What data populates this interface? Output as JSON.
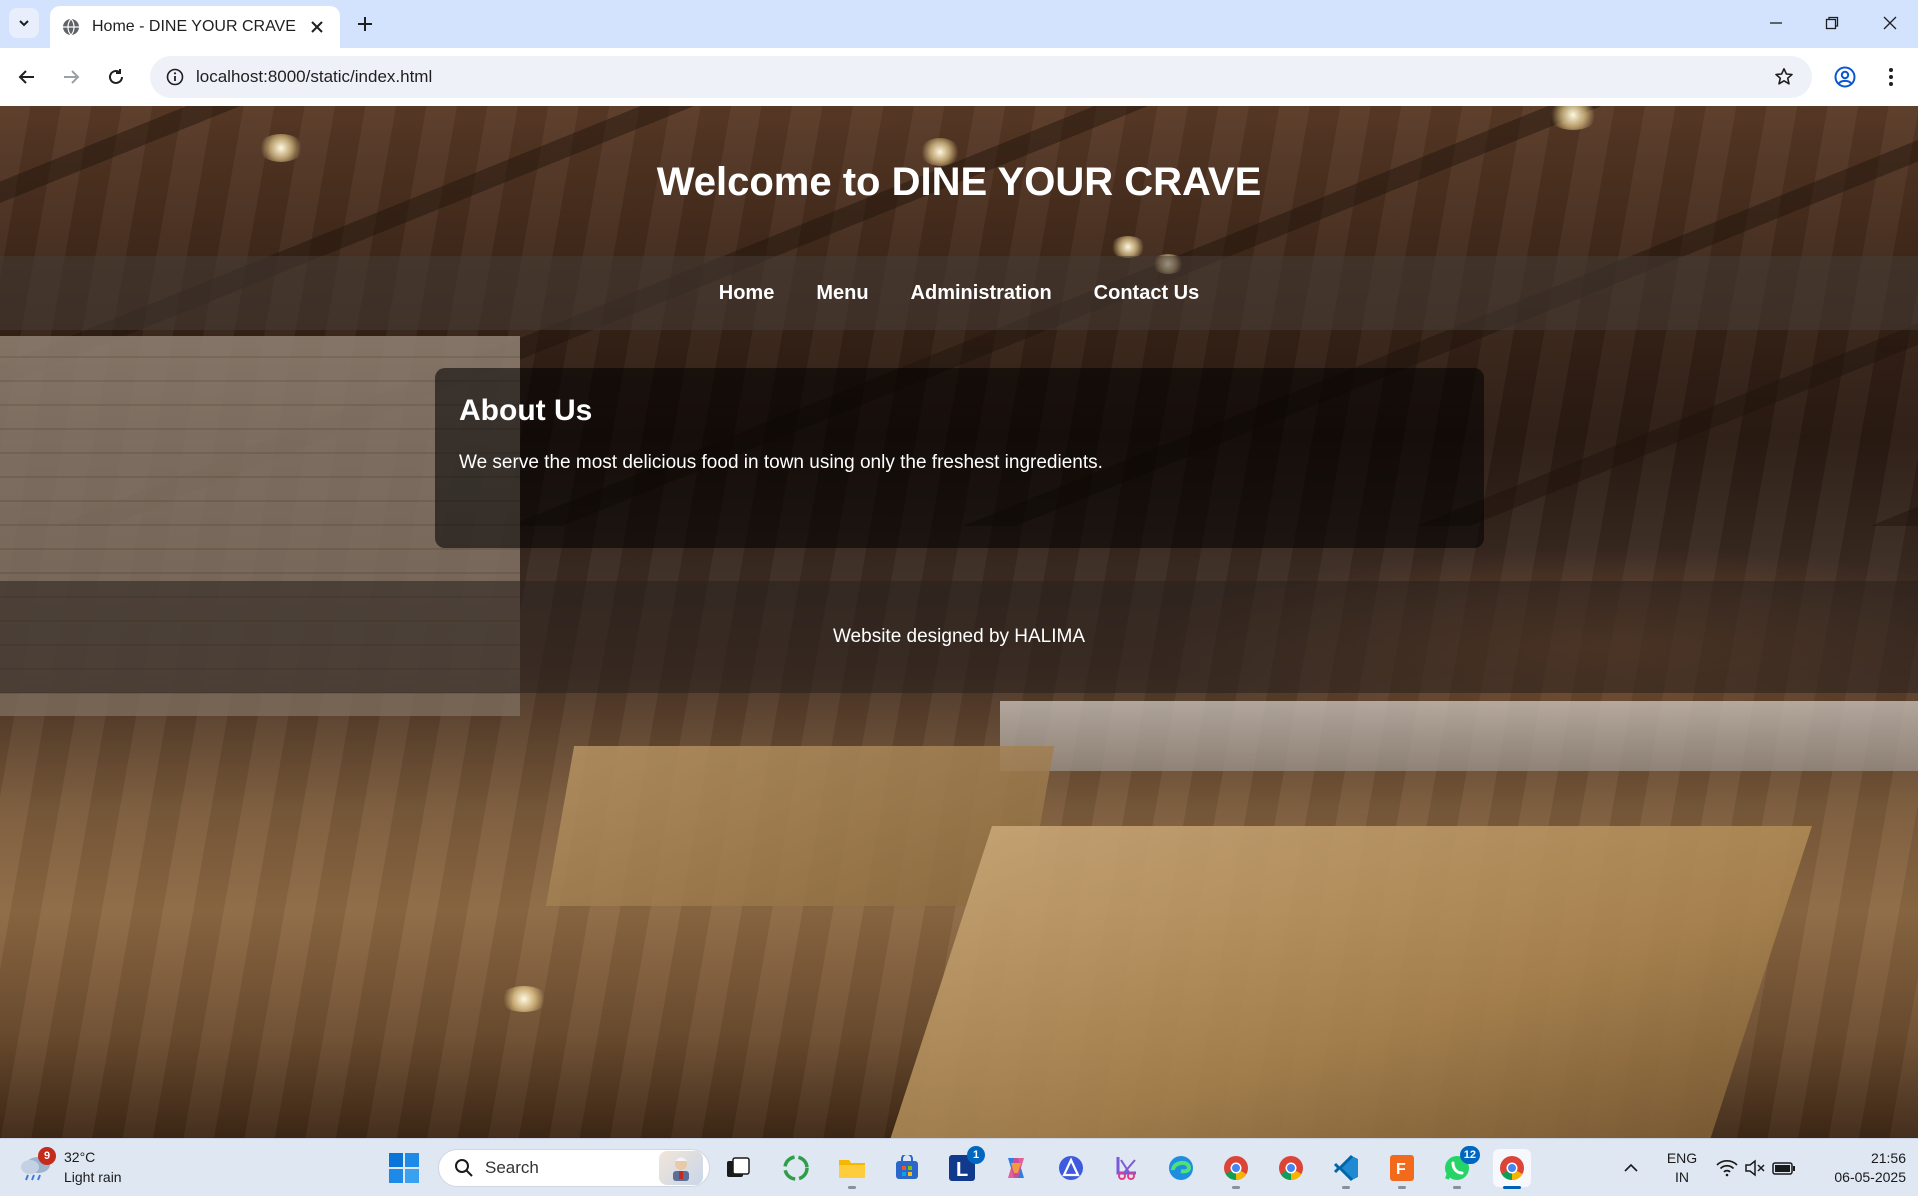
{
  "browser": {
    "tab_title": "Home - DINE YOUR CRAVE",
    "url": "localhost:8000/static/index.html"
  },
  "site": {
    "title": "Welcome to DINE YOUR CRAVE",
    "nav": [
      "Home",
      "Menu",
      "Administration",
      "Contact Us"
    ],
    "about_heading": "About Us",
    "about_text": "We serve the most delicious food in town using only the freshest ingredients.",
    "footer_text": "Website designed by HALIMA"
  },
  "taskbar": {
    "weather_badge": "9",
    "weather_temp": "32°C",
    "weather_condition": "Light rain",
    "search_placeholder": "Search",
    "apps": [
      {
        "name": "task-view-icon"
      },
      {
        "name": "copilot-ring-icon"
      },
      {
        "name": "file-explorer-icon"
      },
      {
        "name": "microsoft-store-icon"
      },
      {
        "name": "l-app-icon",
        "badge": "1"
      },
      {
        "name": "copilot-icon"
      },
      {
        "name": "delta-app-icon"
      },
      {
        "name": "snipping-tool-icon"
      },
      {
        "name": "edge-icon"
      },
      {
        "name": "chrome-icon"
      },
      {
        "name": "chrome-profile-icon"
      },
      {
        "name": "vscode-icon"
      },
      {
        "name": "fxs-app-icon"
      },
      {
        "name": "whatsapp-icon",
        "badge": "12"
      },
      {
        "name": "chrome-active-icon"
      }
    ],
    "lang_line1": "ENG",
    "lang_line2": "IN",
    "time": "21:56",
    "date": "06-05-2025"
  },
  "colors": {
    "tabbar_bg": "#d3e3fd",
    "taskbar_bg": "#dfe7f3",
    "accent": "#005fb8"
  }
}
